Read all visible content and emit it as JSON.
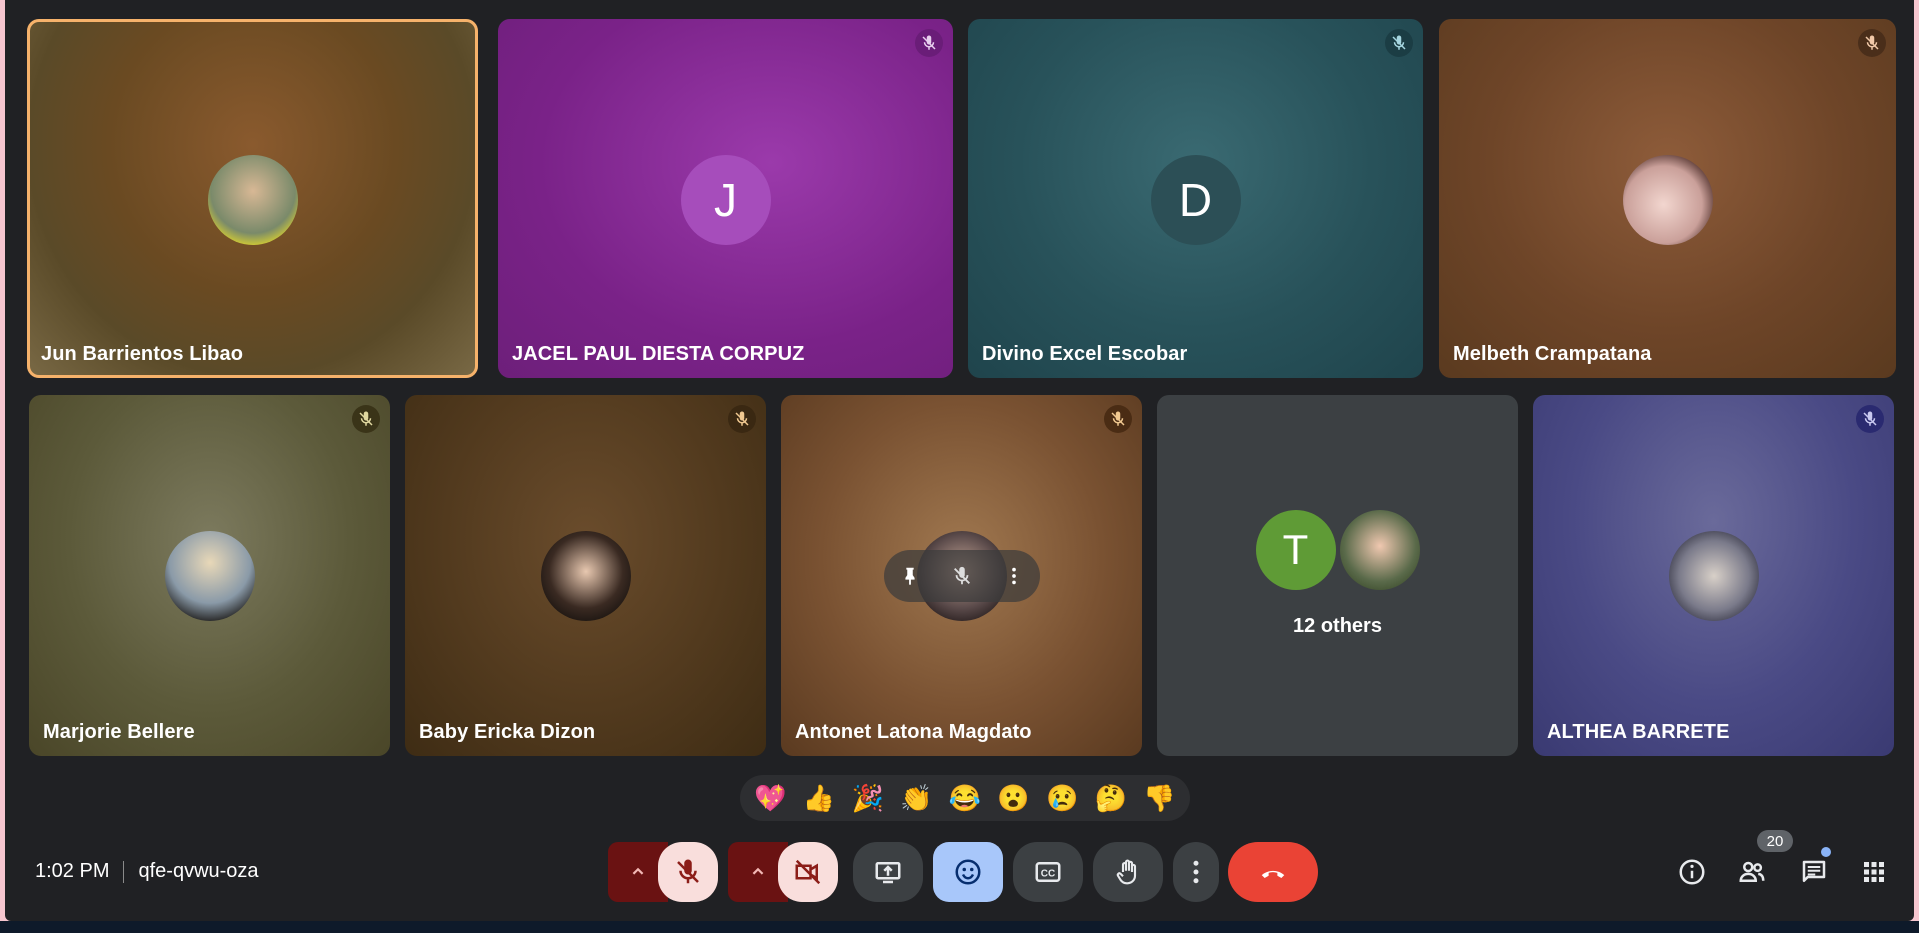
{
  "participants": [
    {
      "name": "Jun Barrientos Libao",
      "active": true,
      "bg": "#7a5530",
      "avatar": "photo"
    },
    {
      "name": "JACEL PAUL DIESTA CORPUZ",
      "muted": true,
      "bg": "#8b2d95",
      "initial": "J",
      "initial_color": "#a64dbb"
    },
    {
      "name": "Divino Excel Escobar",
      "muted": true,
      "bg": "#285c66",
      "initial": "D",
      "initial_color": "#2c4f56"
    },
    {
      "name": "Melbeth Crampatana",
      "muted": true,
      "bg": "#7a5033",
      "avatar": "photo"
    },
    {
      "name": "Marjorie Bellere",
      "muted": true,
      "bg": "#6e6a4a",
      "avatar": "photo"
    },
    {
      "name": "Baby Ericka Dizon",
      "muted": true,
      "bg": "#5a4125",
      "avatar": "photo"
    },
    {
      "name": "Antonet Latona Magdato",
      "muted": true,
      "bg": "#6e4a2c",
      "avatar": "photo"
    },
    {
      "name": "12 others",
      "others_initial": "T",
      "others_initial_color": "#5f9b36"
    },
    {
      "name": "ALTHEA BARRETE",
      "muted": true,
      "bg": "#4b4a85",
      "avatar": "photo"
    }
  ],
  "reactions": [
    "💖",
    "👍",
    "🎉",
    "👏",
    "😂",
    "😮",
    "😢",
    "🤔",
    "👎"
  ],
  "meeting": {
    "time": "1:02 PM",
    "code": "qfe-qvwu-oza"
  },
  "people_count": "20",
  "icons": {
    "mic": "mic-off-icon",
    "camera": "camera-off-icon",
    "present": "present-screen-icon",
    "emoji": "emoji-icon",
    "captions": "captions-icon",
    "hand": "raise-hand-icon",
    "more": "more-vert-icon",
    "leave": "call-end-icon",
    "info": "info-icon",
    "people": "people-icon",
    "chat": "chat-icon",
    "apps": "apps-grid-icon"
  },
  "colors": {
    "leave": "#ea4335",
    "emoji_active": "#a8c7fa",
    "muted_control": "#f9dedc",
    "active_border": "#f6b26b"
  }
}
